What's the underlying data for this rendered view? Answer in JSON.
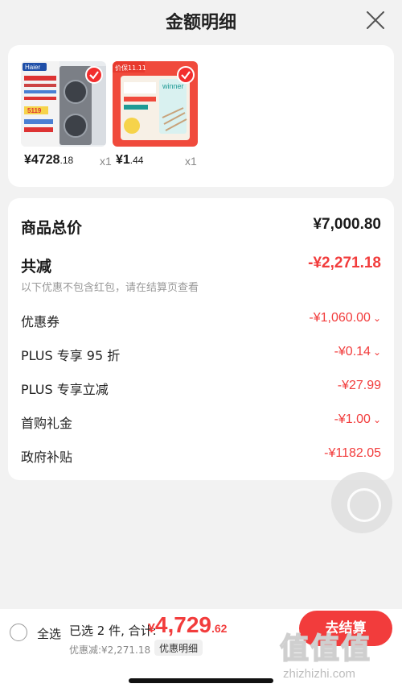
{
  "header": {
    "title": "金额明细",
    "close_icon": "close-icon"
  },
  "products": [
    {
      "price_int": "¥4728",
      "price_dec": ".18",
      "qty": "x1",
      "selected": true,
      "brand": "Haier",
      "badge_text": "5119"
    },
    {
      "price_int": "¥1",
      "price_dec": ".44",
      "qty": "x1",
      "selected": true,
      "brand": "winner",
      "badge_text": "价保11.11"
    }
  ],
  "summary": {
    "total_label": "商品总价",
    "total_value": "¥7,000.80",
    "reduce_label": "共减",
    "reduce_value": "-¥2,271.18",
    "note": "以下优惠不包含红包，请在结算页查看",
    "items": [
      {
        "label": "优惠券",
        "value": "-¥1,060.00",
        "expandable": true
      },
      {
        "label": "PLUS 专享 95 折",
        "value": "-¥0.14",
        "expandable": true
      },
      {
        "label": "PLUS 专享立减",
        "value": "-¥27.99",
        "expandable": false
      },
      {
        "label": "首购礼金",
        "value": "-¥1.00",
        "expandable": true
      },
      {
        "label": "政府补贴",
        "value": "-¥1182.05",
        "expandable": false
      }
    ]
  },
  "footer": {
    "select_all": "全选",
    "selected_count": "已选 2 件, 合计:",
    "total_currency": "¥",
    "total_int": "4,729",
    "total_dec": ".62",
    "discount_line": "优惠减:¥2,271.18",
    "detail_tag": "优惠明细",
    "checkout": "去结算"
  },
  "watermark": {
    "chars": "值值值",
    "url": "zhizhizhi.com"
  },
  "colors": {
    "accent": "#f23c3c",
    "background": "#f2f2f2"
  }
}
